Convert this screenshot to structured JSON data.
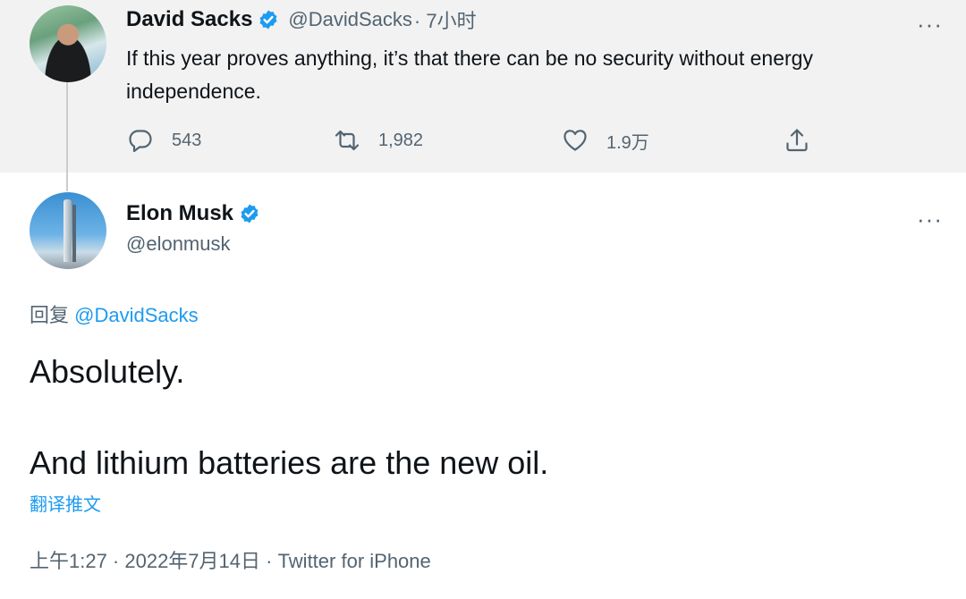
{
  "parent_tweet": {
    "author_name": "David Sacks",
    "author_handle": "@DavidSacks",
    "time": "· 7小时",
    "text": "If this year proves anything, it’s that there can be no security without energy independence.",
    "replies": "543",
    "retweets": "1,982",
    "likes": "1.9万",
    "more": "···"
  },
  "main_tweet": {
    "author_name": "Elon Musk",
    "author_handle": "@elonmusk",
    "more": "···",
    "reply_prefix": "回复 ",
    "reply_mention": "@DavidSacks",
    "line1": "Absolutely.",
    "line2": "And lithium batteries are the new oil.",
    "translate_label": "翻译推文",
    "meta": "上午1:27 · 2022年7月14日 · Twitter for iPhone"
  },
  "icons": {
    "verified": "verified-badge-icon",
    "reply": "reply-icon",
    "retweet": "retweet-icon",
    "like": "heart-icon",
    "share": "share-icon",
    "more": "more-icon"
  },
  "colors": {
    "accent": "#1d9bf0",
    "secondary_text": "#536471",
    "parent_background": "#f2f2f2"
  }
}
